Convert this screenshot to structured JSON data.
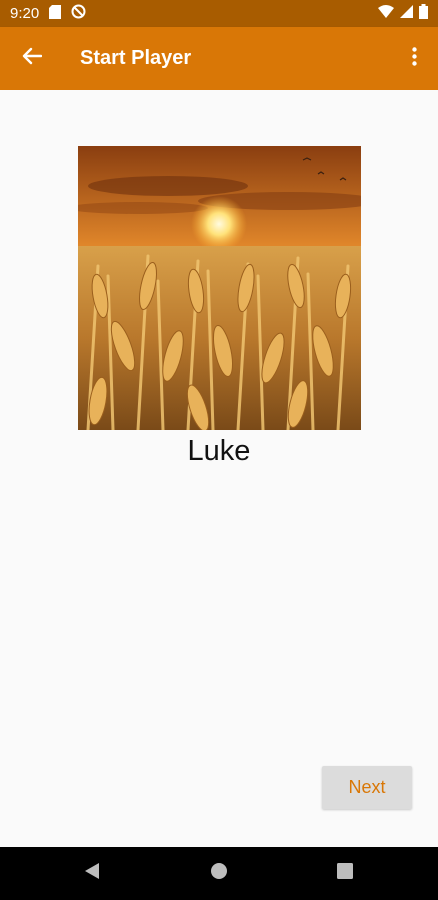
{
  "status_bar": {
    "time": "9:20",
    "left_icons": [
      "sd-card-icon",
      "no-disturb-icon"
    ],
    "right_icons": [
      "wifi-icon",
      "cell-signal-icon",
      "battery-icon"
    ]
  },
  "app_bar": {
    "title": "Start Player",
    "back_icon": "arrow-left-icon",
    "menu_icon": "more-vert-icon",
    "color": "#d97706"
  },
  "player": {
    "name": "Luke",
    "image": "wheat-field-sunset"
  },
  "actions": {
    "next_label": "Next"
  },
  "nav_bar": {
    "items": [
      "back-triangle-icon",
      "home-circle-icon",
      "recents-square-icon"
    ]
  }
}
